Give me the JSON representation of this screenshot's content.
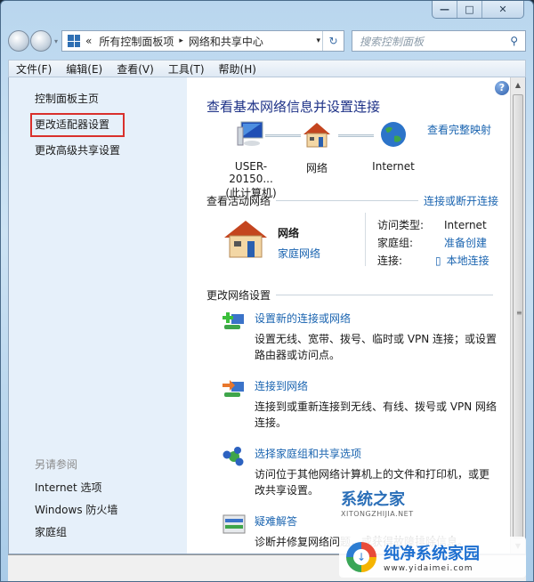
{
  "window": {
    "caption_buttons": {
      "minimize": "—",
      "maximize": "□",
      "close": "✕"
    }
  },
  "nav": {
    "back_icon": "back-arrow-icon",
    "forward_icon": "forward-arrow-icon",
    "recent_dropdown": "▾",
    "breadcrumb": {
      "overflow": "«",
      "items": [
        "所有控制面板项",
        "网络和共享中心"
      ],
      "separator": "▸"
    },
    "address_dropdown": "▾",
    "refresh": "↻",
    "search_placeholder": "搜索控制面板",
    "search_icon": "⚲"
  },
  "menubar": {
    "items": [
      "文件(F)",
      "编辑(E)",
      "查看(V)",
      "工具(T)",
      "帮助(H)"
    ]
  },
  "sidebar": {
    "links": [
      "控制面板主页",
      "更改适配器设置",
      "更改高级共享设置"
    ],
    "highlighted": "更改适配器设置",
    "see_also": {
      "header": "另请参阅",
      "links": [
        "Internet 选项",
        "Windows 防火墙",
        "家庭组"
      ]
    }
  },
  "main": {
    "help": "?",
    "title": "查看基本网络信息并设置连接",
    "full_map_link": "查看完整映射",
    "map": {
      "nodes": [
        {
          "label": "USER-20150...",
          "sub": "(此计算机)",
          "icon": "computer-icon"
        },
        {
          "label": "网络",
          "sub": "",
          "icon": "house-icon"
        },
        {
          "label": "Internet",
          "sub": "",
          "icon": "globe-icon"
        }
      ]
    },
    "active_networks": {
      "header": "查看活动网络",
      "action_link": "连接或断开连接",
      "network_name": "网络",
      "network_type": "家庭网络",
      "props": [
        {
          "key": "访问类型:",
          "value": "Internet",
          "link": false
        },
        {
          "key": "家庭组:",
          "value": "准备创建",
          "link": true
        },
        {
          "key": "连接:",
          "value": "本地连接",
          "link": true
        }
      ]
    },
    "change_settings": {
      "header": "更改网络设置",
      "tasks": [
        {
          "title": "设置新的连接或网络",
          "desc": "设置无线、宽带、拨号、临时或 VPN 连接；或设置路由器或访问点。"
        },
        {
          "title": "连接到网络",
          "desc": "连接到或重新连接到无线、有线、拨号或 VPN 网络连接。"
        },
        {
          "title": "选择家庭组和共享选项",
          "desc": "访问位于其他网络计算机上的文件和打印机，或更改共享设置。"
        },
        {
          "title": "疑难解答",
          "desc": "诊断并修复网络问题，或获得故障排除信息。"
        }
      ]
    }
  },
  "scrollbar": {
    "up": "▲",
    "down": "▼",
    "grip": "≡"
  },
  "watermarks": {
    "one": {
      "text": "系统之家",
      "sub": "XITONGZHIJIA.NET"
    },
    "two": {
      "text": "纯净系统家园",
      "sub": "www.yidaimei.com"
    }
  },
  "colors": {
    "link": "#1a64b0",
    "title": "#1e3287",
    "sidebar_bg": "#e6f0fa",
    "highlight_box": "#d9302c"
  }
}
